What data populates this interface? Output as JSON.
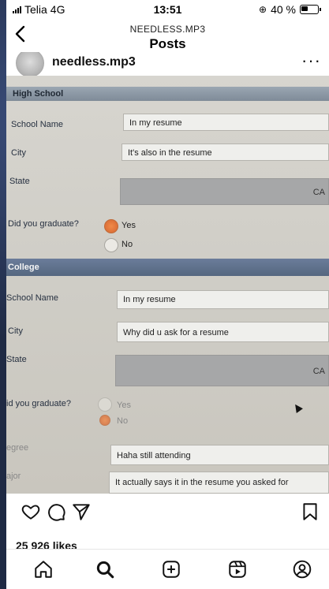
{
  "status": {
    "carrier": "Telia",
    "network": "4G",
    "time": "13:51",
    "battery": "40 %"
  },
  "header": {
    "back_icon": "chevron-left-icon",
    "subtitle": "NEEDLESS.MP3",
    "title": "Posts"
  },
  "post": {
    "username": "needless.mp3",
    "more_icon": "more-dots-icon",
    "likes": "25 926 likes",
    "photo": {
      "high_school_section": "High School",
      "hs_school_name_label": "School Name",
      "hs_school_name_value": "In my resume",
      "hs_city_label": "City",
      "hs_city_value": "It's also in the resume",
      "hs_state_label": "State",
      "hs_state_value": "CA",
      "hs_graduate_label": "Did you graduate?",
      "hs_yes": "Yes",
      "hs_no": "No",
      "college_section": "College",
      "c_school_name_label": "School Name",
      "c_school_name_value": "In my resume",
      "c_city_label": "City",
      "c_city_value": "Why did u ask for a resume",
      "c_state_label": "State",
      "c_state_value": "CA",
      "c_graduate_label": "id you graduate?",
      "c_yes": "Yes",
      "c_no": "No",
      "degree_label": "egree",
      "degree_value": "Haha still attending",
      "major_label": "ajor",
      "major_value": "It actually says it in the resume you asked for"
    }
  },
  "actions": {
    "like_icon": "heart-icon",
    "comment_icon": "comment-icon",
    "share_icon": "send-icon",
    "save_icon": "bookmark-icon"
  },
  "nav": {
    "home_icon": "home-icon",
    "search_icon": "search-icon",
    "create_icon": "plus-square-icon",
    "reels_icon": "reels-icon",
    "profile_icon": "profile-icon"
  }
}
